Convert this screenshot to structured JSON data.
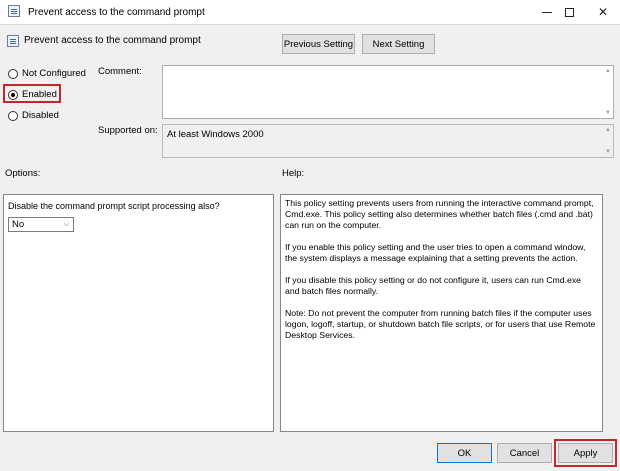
{
  "window": {
    "title": "Prevent access to the command prompt",
    "controls": {
      "minimize": "min",
      "maximize": "max",
      "close": "✕"
    }
  },
  "header": {
    "setting_name": "Prevent access to the command prompt",
    "previous_button": "Previous Setting",
    "next_button": "Next Setting"
  },
  "state": {
    "options": [
      {
        "label": "Not Configured",
        "checked": false
      },
      {
        "label": "Enabled",
        "checked": true
      },
      {
        "label": "Disabled",
        "checked": false
      }
    ]
  },
  "comment": {
    "label": "Comment:",
    "value": ""
  },
  "supported": {
    "label": "Supported on:",
    "value": "At least Windows 2000"
  },
  "options_panel": {
    "label": "Options:",
    "question": "Disable the command prompt script processing also?",
    "select_value": "No"
  },
  "help_panel": {
    "label": "Help:",
    "paragraphs": [
      "This policy setting prevents users from running the interactive command prompt, Cmd.exe.  This policy setting also determines whether batch files (.cmd and .bat) can run on the computer.",
      "If you enable this policy setting and the user tries to open a command window, the system displays a message explaining that a setting prevents the action.",
      "If you disable this policy setting or do not configure it, users can run Cmd.exe and batch files normally.",
      "Note: Do not prevent the computer from running batch files if the computer uses logon, logoff, startup, or shutdown batch file scripts, or for users that use Remote Desktop Services."
    ]
  },
  "footer": {
    "ok": "OK",
    "cancel": "Cancel",
    "apply": "Apply"
  },
  "colors": {
    "highlight": "#c4262e",
    "accent": "#0078d7",
    "background": "#f0f0f0"
  },
  "icons": {
    "app": "policy-icon",
    "setting": "policy-icon"
  }
}
